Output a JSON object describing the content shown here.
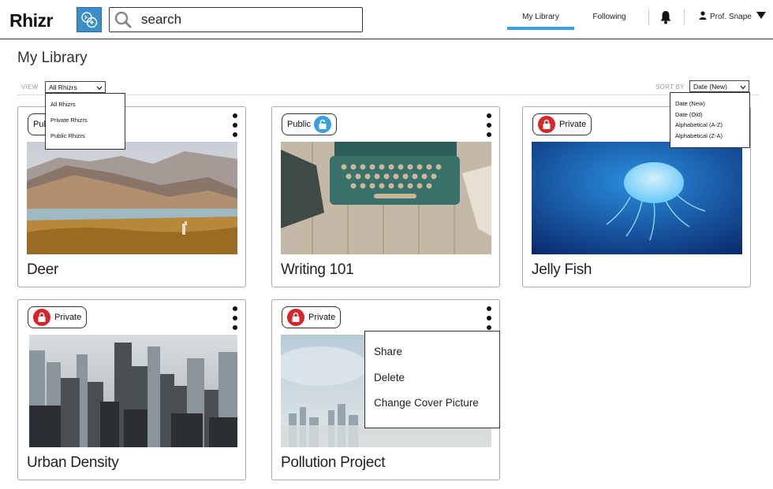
{
  "app": {
    "logo": "Rhizr"
  },
  "search": {
    "placeholder": "search"
  },
  "nav": {
    "tabs": [
      {
        "label": "My Library",
        "active": true
      },
      {
        "label": "Following",
        "active": false
      }
    ],
    "user": "Prof. Snape",
    "accent": "#3aa0dd"
  },
  "page": {
    "title": "My Library"
  },
  "toolbar": {
    "view_label": "VIEW",
    "view_value": "All Rhizrs",
    "view_options": [
      "All Rhizrs",
      "Private Rhizrs",
      "Public Rhizrs"
    ],
    "sort_label": "SORT BY",
    "sort_value": "Date (New)",
    "sort_options": [
      "Date (New)",
      "Date (Old)",
      "Alphabetical (A-Z)",
      "Alphabetical (Z-A)"
    ]
  },
  "cards": [
    {
      "title": "Deer",
      "visibility": "Public",
      "cover": "mountain-lake-deer"
    },
    {
      "title": "Writing 101",
      "visibility": "Public",
      "cover": "typewriter-on-wood"
    },
    {
      "title": "Jelly Fish",
      "visibility": "Private",
      "cover": "jellyfish-underwater"
    },
    {
      "title": "Urban Density",
      "visibility": "Private",
      "cover": "city-skyline"
    },
    {
      "title": "Pollution Project",
      "visibility": "Private",
      "cover": "smoggy-skyline"
    }
  ],
  "context_menu": {
    "items": [
      "Share",
      "Delete",
      "Change Cover Picture"
    ]
  },
  "colors": {
    "public_lock": "#3aa0dd",
    "private_lock": "#d7262b",
    "header_button": "#3a8ec9"
  }
}
